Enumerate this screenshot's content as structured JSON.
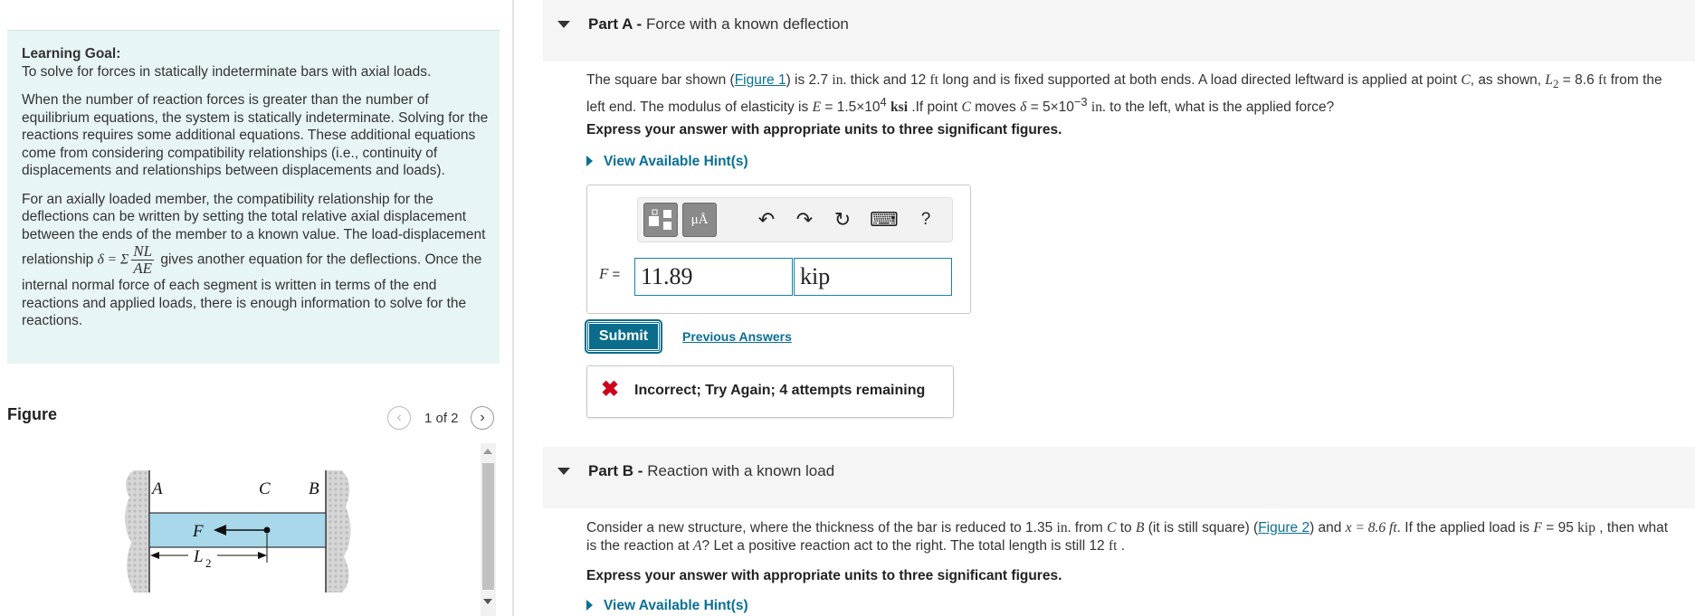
{
  "learning_goal": {
    "title": "Learning Goal:",
    "subtitle": "To solve for forces in statically indeterminate bars with axial loads.",
    "para1": "When the number of reaction forces is greater than the number of equilibrium equations, the system is statically indeterminate. Solving for the reactions requires some additional equations. These additional equations come from considering compatibility relationships (i.e., continuity of displacements and relationships between displacements and loads).",
    "para2_a": "For an axially loaded member, the compatibility relationship for the deflections can be written by setting the total relative axial displacement between the ends of the member to a known value. The load-displacement relationship",
    "para2_formula_lhs": "δ = Σ",
    "para2_formula_num": "NL",
    "para2_formula_den": "AE",
    "para2_b": "gives another equation for the deflections. Once the internal normal force of each segment is written in terms of the end reactions and applied loads, there is enough information to solve for the reactions."
  },
  "figure": {
    "label": "Figure",
    "pager": "1 of 2",
    "labels": {
      "A": "A",
      "C": "C",
      "B": "B",
      "F": "F",
      "L": "L",
      "L_sub": "2"
    }
  },
  "partA": {
    "label": "Part A -",
    "title": "Force with a known deflection",
    "text": {
      "t1": "The square bar shown (",
      "fig_link": "Figure 1",
      "t2": ") is 2.7 ",
      "u_in": "in.",
      "t3": " thick and 12 ",
      "u_ft": "ft",
      "t4": " long and is fixed supported at both ends. A load directed leftward is applied at point ",
      "pt_C": "C",
      "t5": ", as shown, ",
      "L2": "L",
      "L2_sub": "2",
      "t6": " = 8.6 ",
      "u_ft2": "ft",
      "t7": " from the left end. The modulus of elasticity is ",
      "E": "E",
      "t8": " = 1.5×10",
      "E_exp": "4",
      "t9": " ",
      "u_ksi": "ksi",
      "t10": " .If point ",
      "pt_C2": "C",
      "t11": " moves ",
      "delta": "δ",
      "t12": " = 5×10",
      "d_exp": "−3",
      "t13": " ",
      "u_in2": "in.",
      "t14": " to the left, what is the applied force?"
    },
    "instruction": "Express your answer with appropriate units to three significant figures.",
    "hint": "View Available Hint(s)",
    "toolbar": {
      "units_label": "μÅ",
      "undo": "↶",
      "redo": "↷",
      "reset": "↻",
      "keyboard": "⌨",
      "help": "?"
    },
    "answer_label": "F",
    "answer_eq": " =",
    "value": "11.89",
    "unit": "kip",
    "submit": "Submit",
    "previous_answers": "Previous Answers",
    "feedback": "Incorrect; Try Again; 4 attempts remaining"
  },
  "partB": {
    "label": "Part B -",
    "title": "Reaction with a known load",
    "text": {
      "t1": "Consider a new structure, where the thickness of the bar is reduced to 1.35 ",
      "u_in": "in.",
      "t2": " from ",
      "pt_C": "C",
      "t3": " to ",
      "pt_B": "B",
      "t4": " (it is still square) (",
      "fig_link": "Figure 2",
      "t5": ") and ",
      "x_eq": "x = 8.6 ft",
      "t6": ". If the applied load is ",
      "F": "F",
      "t7": " = 95 ",
      "u_kip": "kip",
      "t8": " , then what is the reaction at ",
      "pt_A": "A",
      "t9": "? Let a positive reaction act to the right. The total length is still 12 ",
      "u_ft": "ft",
      "t10": " ."
    },
    "instruction": "Express your answer with appropriate units to three significant figures.",
    "hint": "View Available Hint(s)"
  },
  "colors": {
    "accent": "#0a6f95",
    "goal_bg": "#e8f5f5",
    "bar_fill": "#a8d8ea",
    "error": "#d0021b"
  }
}
